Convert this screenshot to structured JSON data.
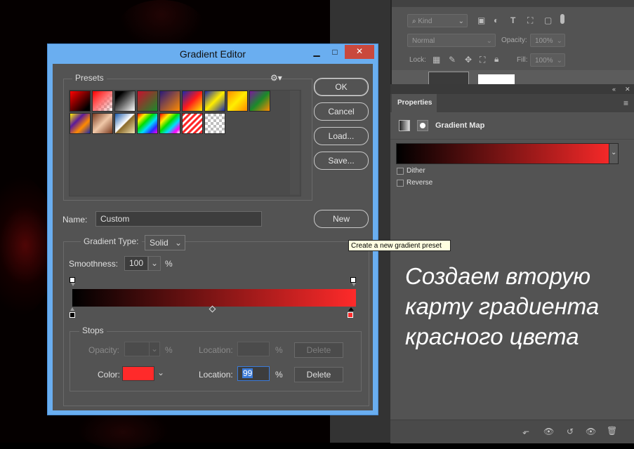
{
  "dialog": {
    "title": "Gradient Editor",
    "presets_label": "Presets",
    "presets": [
      {
        "name": "foreground-to-background",
        "bg": "linear-gradient(135deg,#ff0000 0%,#000 85%)"
      },
      {
        "name": "foreground-to-transparent",
        "bg": "linear-gradient(135deg,#ff0000 0%,#ff6a6a 45%,rgba(255,255,255,0) 100%)",
        "checker": true
      },
      {
        "name": "black-white",
        "bg": "linear-gradient(135deg,#000 20%,#fff 100%)"
      },
      {
        "name": "red-green",
        "bg": "linear-gradient(135deg,#c8102e 0%,#1a8a2a 100%)"
      },
      {
        "name": "violet-orange",
        "bg": "linear-gradient(135deg,#2a1a7a 0%,#ff8a00 100%)"
      },
      {
        "name": "blue-red-yellow",
        "bg": "linear-gradient(135deg,#1a2aaa 0%,#ff1a1a 50%,#ffee00 100%)"
      },
      {
        "name": "blue-yellow-blue",
        "bg": "linear-gradient(135deg,#1a2aaa 0%,#ffee00 50%,#1a2aaa 100%)"
      },
      {
        "name": "orange-yellow-orange",
        "bg": "linear-gradient(135deg,#ff8a00 0%,#ffee00 50%,#ff8a00 100%)"
      },
      {
        "name": "violet-green-orange",
        "bg": "linear-gradient(135deg,#7a1a9a 0%,#1a8a2a 50%,#ff8a00 100%)"
      },
      {
        "name": "yellow-violet-orange-blue",
        "bg": "linear-gradient(135deg,#ffee00 0%,#5a1a9a 35%,#ff8a00 65%,#1a2aaa 100%)"
      },
      {
        "name": "copper",
        "bg": "linear-gradient(135deg,#7a3a20 0%,#f0c8a8 50%,#7a3a20 100%)"
      },
      {
        "name": "chrome",
        "bg": "linear-gradient(135deg,#1a5aaa 0%,#ffffff 48%,#8a6a2a 52%,#f0e0b0 100%)"
      },
      {
        "name": "spectrum",
        "bg": "linear-gradient(135deg,#ff0000 0%,#ffee00 20%,#00dd00 40%,#00ddff 60%,#2a2aff 80%,#ff00ff 100%)"
      },
      {
        "name": "transparent-rainbow",
        "bg": "linear-gradient(135deg,#ff0000 0%,#ffee00 25%,#00dd00 45%,#00ddff 65%,#ff00ff 85%,rgba(255,255,255,0) 100%)",
        "checker": true
      },
      {
        "name": "transparent-stripes",
        "bg": "repeating-linear-gradient(135deg,#ff2a2a 0px,#ff2a2a 3px,#ffffff 3px,#ffffff 6px)"
      },
      {
        "name": "transparent",
        "bg": "transparent",
        "checker": true
      }
    ],
    "buttons": {
      "ok": "OK",
      "cancel": "Cancel",
      "load": "Load...",
      "save": "Save...",
      "new": "New"
    },
    "name_label": "Name:",
    "name_value": "Custom",
    "gradient_type_label": "Gradient Type:",
    "gradient_type_value": "Solid",
    "smoothness_label": "Smoothness:",
    "smoothness_value": "100",
    "smoothness_unit": "%",
    "gradient_colors": [
      "#000000",
      "#ff2a2a"
    ],
    "stops_label": "Stops",
    "opacity_label": "Opacity:",
    "opacity_unit": "%",
    "opacity_location_label": "Location:",
    "opacity_location_unit": "%",
    "opacity_delete": "Delete",
    "color_label": "Color:",
    "color_value": "#ff2a2a",
    "color_location_label": "Location:",
    "color_location_value": "99",
    "color_location_unit": "%",
    "color_delete": "Delete"
  },
  "tooltip": "Create a new gradient preset",
  "layers": {
    "filter_value": "Kind",
    "blend_mode": "Normal",
    "opacity_label": "Opacity:",
    "opacity_value": "100%",
    "lock_label": "Lock:",
    "fill_label": "Fill:",
    "fill_value": "100%"
  },
  "properties": {
    "tab_label": "Properties",
    "adjustment_title": "Gradient Map",
    "gradient_colors": [
      "#000000",
      "#ff2a2a"
    ],
    "dither_label": "Dither",
    "reverse_label": "Reverse"
  },
  "caption": [
    "Создаем вторую",
    "карту градиента",
    "красного цвета"
  ]
}
